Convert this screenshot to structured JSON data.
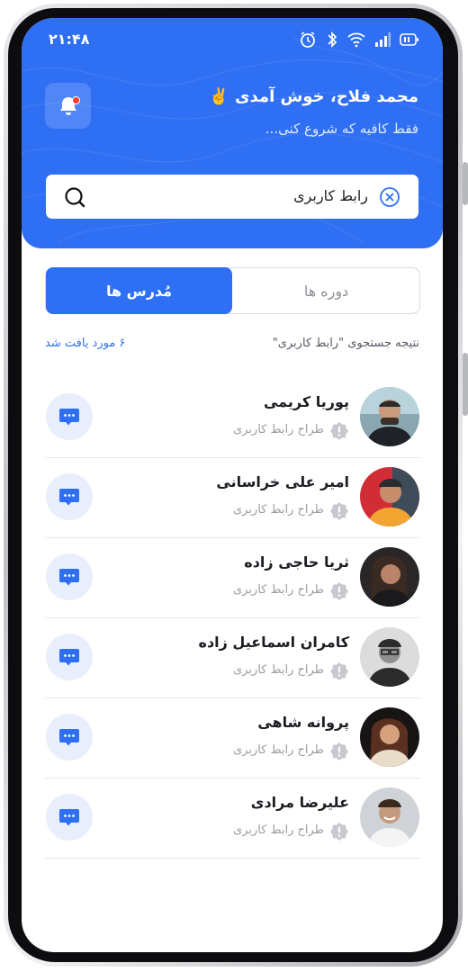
{
  "status_bar": {
    "time": "۲۱:۴۸"
  },
  "header": {
    "greeting": "محمد فلاح، خوش آمدی ✌️",
    "subtitle": "فقط کافیه که شروع کنی...",
    "notification_icon": "bell-icon"
  },
  "search": {
    "value": "رابط کاربری",
    "icon": "search-icon",
    "clear_icon": "clear-icon"
  },
  "tabs": [
    {
      "label": "دوره ها",
      "active": false
    },
    {
      "label": "مُدرس ها",
      "active": true
    }
  ],
  "results": {
    "query_text": "نتیجه جستجوی \"رابط کاربری\"",
    "count_text": "۶ مورد یافت شد"
  },
  "instructors": [
    {
      "name": "پوریا کریمی",
      "role": "طراح رابط کاربری"
    },
    {
      "name": "امیر علی خراسانی",
      "role": "طراح رابط کاربری"
    },
    {
      "name": "ثریا حاجی زاده",
      "role": "طراح رابط کاربری"
    },
    {
      "name": "کامران اسماعیل زاده",
      "role": "طراح رابط کاربری"
    },
    {
      "name": "پروانه شاهی",
      "role": "طراح رابط کاربری"
    },
    {
      "name": "علیرضا مرادی",
      "role": "طراح رابط کاربری"
    }
  ],
  "colors": {
    "primary": "#2f6ff3",
    "chat_bg": "#e8eefb",
    "badge": "#c7c9cf"
  }
}
